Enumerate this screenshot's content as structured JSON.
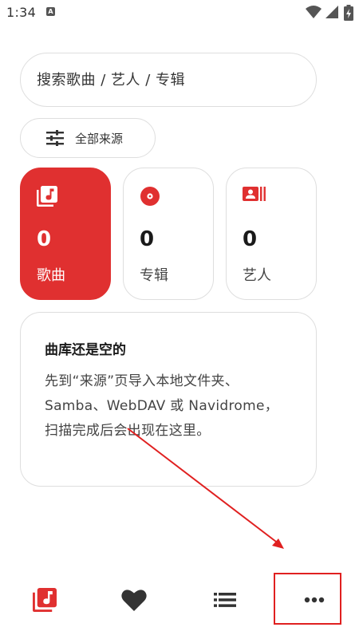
{
  "status_bar": {
    "time": "1:34",
    "notification_badge": "A"
  },
  "search": {
    "placeholder": "搜索歌曲 / 艺人 / 专辑"
  },
  "source_filter": {
    "label": "全部来源"
  },
  "stats": [
    {
      "count": "0",
      "label": "歌曲",
      "icon": "music-library-icon",
      "selected": true
    },
    {
      "count": "0",
      "label": "专辑",
      "icon": "album-disc-icon",
      "selected": false
    },
    {
      "count": "0",
      "label": "艺人",
      "icon": "artist-card-icon",
      "selected": false
    }
  ],
  "empty_state": {
    "title": "曲库还是空的",
    "body": "先到“来源”页导入本地文件夹、Samba、WebDAV 或 Navidrome，扫描完成后会出现在这里。"
  },
  "bottom_nav": [
    {
      "icon": "music-library-icon",
      "active": true
    },
    {
      "icon": "heart-icon",
      "active": false
    },
    {
      "icon": "playlist-icon",
      "active": false
    },
    {
      "icon": "more-icon",
      "active": false
    }
  ],
  "colors": {
    "accent": "#e03030",
    "annotation": "#e02020"
  }
}
